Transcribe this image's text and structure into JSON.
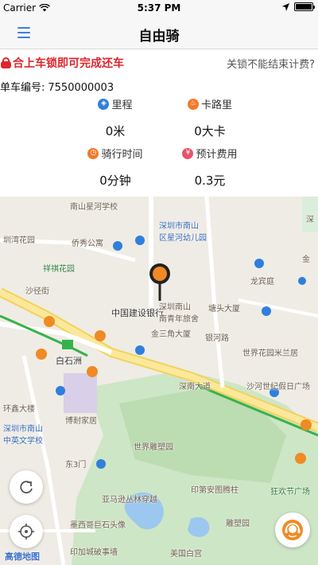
{
  "status_bar": {
    "carrier": "Carrier",
    "time": "5:37 PM"
  },
  "nav": {
    "title": "自由骑"
  },
  "lock": {
    "warning": "合上车锁即可完成还车",
    "note": "关锁不能结束计费?"
  },
  "bike": {
    "label": "单车编号:",
    "number": "7550000003"
  },
  "stats": {
    "distance": {
      "label": "里程",
      "value": "0米"
    },
    "calories": {
      "label": "卡路里",
      "value": "0大卡"
    },
    "duration": {
      "label": "骑行时间",
      "value": "0分钟"
    },
    "cost": {
      "label": "预计费用",
      "value": "0.3元"
    }
  },
  "map": {
    "labels": {
      "nanshan_school": "南山星河学校",
      "district_kindergarten": "深圳市南山\n区星河幼儿园",
      "sz_label": "深",
      "kindergarten_short": "圳湾花园",
      "qiaoxiu": "侨秀公寓",
      "xiangqi": "祥祺花园",
      "jin": "金",
      "shayuan": "沙径街",
      "longbin": "龙宾庭",
      "ccb": "中国建设银行",
      "youth_hostel": "深圳南山\n南青年旅舍",
      "tangtou": "塘头大厦",
      "jinsanjiao": "金三角大厦",
      "yinhe": "银河路",
      "world_garden": "世界花园米兰居",
      "baishizhou": "白石洲",
      "shahe_square": "沙河世纪假日广场",
      "road": "深南大道",
      "huanxin": "环鑫大楼",
      "zhongying": "深圳市南山\n中英文学校",
      "bonai": "博耐家居",
      "east3": "东3门",
      "world_sculpture": "世界雕塑园",
      "yinan": "印第安图腾柱",
      "yamaxun": "亚马逊丛林穿越",
      "kuanghuan": "狂欢节广场",
      "mexico": "墨西哥巨石头像",
      "diaosu": "雕塑园",
      "indian_city": "印加城破事墙",
      "usa_capitol": "美国白宫",
      "amap": "高德地图"
    }
  },
  "colors": {
    "accent": "#3f7fd9",
    "warning": "#e0242c",
    "pin": "#f08a24",
    "metro": "#35b34a"
  }
}
